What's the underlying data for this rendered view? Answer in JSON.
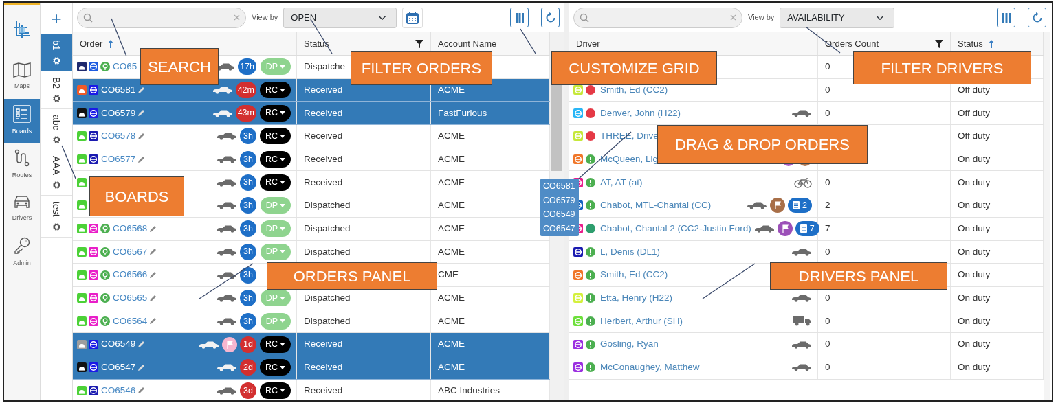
{
  "nav": {
    "items": [
      {
        "label": "Maps",
        "selected": false
      },
      {
        "label": "Boards",
        "selected": true
      },
      {
        "label": "Routes",
        "selected": false
      },
      {
        "label": "Drivers",
        "selected": false
      },
      {
        "label": "Admin",
        "selected": false
      }
    ]
  },
  "boards": {
    "add": "+",
    "tabs": [
      {
        "label": "b1",
        "selected": true
      },
      {
        "label": "B2",
        "selected": false
      },
      {
        "label": "abc",
        "selected": false
      },
      {
        "label": "AAA",
        "selected": false
      },
      {
        "label": "test",
        "selected": false
      }
    ]
  },
  "orders_panel": {
    "view_by_label": "View by",
    "view_by": "OPEN",
    "columns": [
      {
        "label": "Order",
        "sorted": true
      },
      {
        "label": "Status",
        "filtered": true
      },
      {
        "label": "Account Name"
      }
    ],
    "rows": [
      {
        "badges": [
          {
            "kind": "gauge",
            "color": "#1f2a6e"
          },
          {
            "kind": "wheel",
            "color": "#1e5be0"
          },
          {
            "kind": "round",
            "color": "#4caf50"
          }
        ],
        "order": "CO65",
        "selected": false,
        "flag": false,
        "age": {
          "label": "17h",
          "color": "#1e6fc7"
        },
        "stage": {
          "label": "DP",
          "color": "#8fd48f"
        },
        "status": "Dispatche"
      },
      {
        "badges": [
          {
            "kind": "gauge",
            "color": "#f05a28"
          },
          {
            "kind": "wheel",
            "color": "#1a1ae6"
          }
        ],
        "order": "CO6581",
        "selected": true,
        "flag": false,
        "age": {
          "label": "42m",
          "color": "#d32f2f"
        },
        "stage": {
          "label": "RC",
          "color": "#000000"
        },
        "status": "Received",
        "account": "ACME"
      },
      {
        "badges": [
          {
            "kind": "gauge",
            "color": "#111111"
          },
          {
            "kind": "wheel",
            "color": "#1a1ae6"
          }
        ],
        "order": "CO6579",
        "selected": true,
        "flag": false,
        "age": {
          "label": "43m",
          "color": "#d32f2f"
        },
        "stage": {
          "label": "RC",
          "color": "#000000"
        },
        "status": "Received",
        "account": "FastFurious"
      },
      {
        "badges": [
          {
            "kind": "gauge",
            "color": "#4cd137"
          },
          {
            "kind": "wheel",
            "color": "#1a1ab0"
          }
        ],
        "order": "CO6578",
        "selected": false,
        "flag": false,
        "age": {
          "label": "3h",
          "color": "#1e6fc7"
        },
        "stage": {
          "label": "RC",
          "color": "#000000"
        },
        "status": "Received",
        "account": "ACME"
      },
      {
        "badges": [
          {
            "kind": "gauge",
            "color": "#4cd137"
          },
          {
            "kind": "wheel",
            "color": "#1a1ab0"
          }
        ],
        "order": "CO6577",
        "selected": false,
        "flag": false,
        "age": {
          "label": "3h",
          "color": "#1e6fc7"
        },
        "stage": {
          "label": "RC",
          "color": "#000000"
        },
        "status": "Received",
        "account": "ACME"
      },
      {
        "badges": [
          {
            "kind": "gauge",
            "color": "#4cd137"
          }
        ],
        "selected": false,
        "flag": false,
        "age": {
          "label": "3h",
          "color": "#1e6fc7"
        },
        "stage": {
          "label": "RC",
          "color": "#000000"
        },
        "status": "Received",
        "account": "ACME"
      },
      {
        "badges": [
          {
            "kind": "gauge",
            "color": "#4cd137"
          }
        ],
        "selected": false,
        "flag": false,
        "age": {
          "label": "3h",
          "color": "#1e6fc7"
        },
        "stage": {
          "label": "DP",
          "color": "#8fd48f"
        },
        "status": "Dispatched",
        "account": "ACME"
      },
      {
        "badges": [
          {
            "kind": "gauge",
            "color": "#4cd137"
          },
          {
            "kind": "wheel",
            "color": "#e91ec8"
          },
          {
            "kind": "round",
            "color": "#4caf50"
          }
        ],
        "order": "CO6568",
        "selected": false,
        "flag": false,
        "age": {
          "label": "3h",
          "color": "#1e6fc7"
        },
        "stage": {
          "label": "DP",
          "color": "#8fd48f"
        },
        "status": "Dispatched",
        "account": "ACME"
      },
      {
        "badges": [
          {
            "kind": "gauge",
            "color": "#4cd137"
          },
          {
            "kind": "wheel",
            "color": "#e91ec8"
          },
          {
            "kind": "round",
            "color": "#4caf50"
          }
        ],
        "order": "CO6567",
        "selected": false,
        "flag": false,
        "age": {
          "label": "3h",
          "color": "#1e6fc7"
        },
        "stage": {
          "label": "DP",
          "color": "#8fd48f"
        },
        "status": "Dispatched",
        "account": "ACME"
      },
      {
        "badges": [
          {
            "kind": "gauge",
            "color": "#4cd137"
          },
          {
            "kind": "wheel",
            "color": "#e91ec8"
          },
          {
            "kind": "round",
            "color": "#4caf50"
          }
        ],
        "order": "CO6566",
        "selected": false,
        "flag": false,
        "age": {
          "label": "3h",
          "color": "#1e6fc7"
        },
        "account": "CME"
      },
      {
        "badges": [
          {
            "kind": "gauge",
            "color": "#4cd137"
          },
          {
            "kind": "wheel",
            "color": "#e91ec8"
          },
          {
            "kind": "round",
            "color": "#4caf50"
          }
        ],
        "order": "CO6565",
        "selected": false,
        "flag": false,
        "age": {
          "label": "3h",
          "color": "#1e6fc7"
        },
        "stage": {
          "label": "DP",
          "color": "#8fd48f"
        },
        "status": "Dispatched",
        "account": "ACME"
      },
      {
        "badges": [
          {
            "kind": "gauge",
            "color": "#4cd137"
          },
          {
            "kind": "wheel",
            "color": "#e91ec8"
          },
          {
            "kind": "round",
            "color": "#4caf50"
          }
        ],
        "order": "CO6564",
        "selected": false,
        "flag": false,
        "age": {
          "label": "3h",
          "color": "#1e6fc7"
        },
        "stage": {
          "label": "DP",
          "color": "#8fd48f"
        },
        "status": "Dispatched",
        "account": "ACME"
      },
      {
        "badges": [
          {
            "kind": "gauge",
            "color": "#9e9e9e"
          },
          {
            "kind": "wheel",
            "color": "#1a1ae6"
          }
        ],
        "order": "CO6549",
        "selected": true,
        "flag": true,
        "age": {
          "label": "1d",
          "color": "#d32f2f"
        },
        "stage": {
          "label": "RC",
          "color": "#000000"
        },
        "status": "Received",
        "account": "ACME"
      },
      {
        "badges": [
          {
            "kind": "gauge",
            "color": "#111111"
          },
          {
            "kind": "wheel",
            "color": "#1a1ae6"
          }
        ],
        "order": "CO6547",
        "selected": true,
        "flag": false,
        "age": {
          "label": "2d",
          "color": "#d32f2f"
        },
        "stage": {
          "label": "RC",
          "color": "#000000"
        },
        "status": "Received",
        "account": "ACME"
      },
      {
        "badges": [
          {
            "kind": "gauge",
            "color": "#4cd137"
          },
          {
            "kind": "wheel",
            "color": "#1a1ab0"
          }
        ],
        "order": "CO6546",
        "selected": false,
        "flag": false,
        "age": {
          "label": "3d",
          "color": "#d32f2f"
        },
        "stage": {
          "label": "RC",
          "color": "#000000"
        },
        "status": "Received",
        "account": "ABC Industries"
      }
    ]
  },
  "drivers_panel": {
    "view_by_label": "View by",
    "view_by": "AVAILABILITY",
    "columns": [
      {
        "label": "Driver"
      },
      {
        "label": "Orders Count",
        "filtered": true
      },
      {
        "label": "Status",
        "sorted": true
      }
    ],
    "rows": [
      {
        "count": "0"
      },
      {
        "square": {
          "color": "#c6e83a"
        },
        "indicator": {
          "kind": "dot",
          "color": "#e53945"
        },
        "name": "Smith, Ed (CC2)",
        "count": "0",
        "status": "Off duty"
      },
      {
        "square": {
          "color": "#29b6f6"
        },
        "indicator": {
          "kind": "dot",
          "color": "#e53945"
        },
        "name": "Denver, John (H22)",
        "vehicle": {
          "kind": "car"
        },
        "count": "0",
        "status": "Off duty"
      },
      {
        "square": {
          "color": "#c6e83a"
        },
        "indicator": {
          "kind": "dot",
          "color": "#e53945"
        },
        "name": "THREE, Drive",
        "status": "Off duty"
      },
      {
        "square": {
          "color": "#f0772a"
        },
        "indicator": {
          "kind": "alert",
          "color": "#4caf50"
        },
        "name": "McQueen, Lig",
        "markers": [
          {
            "kind": "dot",
            "color": "#a55cc4"
          },
          {
            "kind": "dot",
            "color": "#b07a55"
          }
        ],
        "status": "On duty"
      },
      {
        "square": {
          "color": "#e91e8c"
        },
        "indicator": {
          "kind": "alert",
          "color": "#4caf50"
        },
        "name": "AT, AT (at)",
        "vehicle": {
          "kind": "bike"
        },
        "count": "0",
        "status": "On duty"
      },
      {
        "square": {
          "color": "#1565c0"
        },
        "indicator": {
          "kind": "alert",
          "color": "#4caf50"
        },
        "name": "Chabot, MTL-Chantal (CC)",
        "vehicle": {
          "kind": "car"
        },
        "markers": [
          {
            "kind": "flag",
            "color": "#a86f48"
          },
          {
            "kind": "orders",
            "color": "#1e6fc7",
            "count": "2"
          }
        ],
        "count": "2",
        "status": "On duty"
      },
      {
        "square": {
          "color": "#e91e8c"
        },
        "indicator": {
          "kind": "dot",
          "color": "#2e9e6e"
        },
        "name": "Chabot, Chantal 2 (CC2-Justin Ford)",
        "vehicle": {
          "kind": "car"
        },
        "markers": [
          {
            "kind": "flag",
            "color": "#9b4fb8"
          },
          {
            "kind": "orders",
            "color": "#1e6fc7",
            "count": "7"
          }
        ],
        "count": "7",
        "status": "On duty"
      },
      {
        "square": {
          "color": "#1a1ab0"
        },
        "indicator": {
          "kind": "alert",
          "color": "#4caf50"
        },
        "name": "L, Denis (DL1)",
        "vehicle": {
          "kind": "car"
        },
        "count": "0",
        "status": "On duty"
      },
      {
        "square": {
          "color": "#f0772a"
        },
        "indicator": {
          "kind": "alert",
          "color": "#4caf50"
        },
        "name": "Smith, Ed (CC2)",
        "status": "On duty"
      },
      {
        "square": {
          "color": "#d4f03c"
        },
        "indicator": {
          "kind": "alert",
          "color": "#4caf50"
        },
        "name": "Etta, Henry (H22)",
        "vehicle": {
          "kind": "car"
        },
        "count": "0",
        "status": "On duty"
      },
      {
        "square": {
          "color": "#6ee03c"
        },
        "indicator": {
          "kind": "alert",
          "color": "#4caf50"
        },
        "name": "Herbert, Arthur (SH)",
        "vehicle": {
          "kind": "truck"
        },
        "count": "0",
        "status": "On duty"
      },
      {
        "square": {
          "color": "#9b30e0"
        },
        "indicator": {
          "kind": "alert",
          "color": "#4caf50"
        },
        "name": "Gosling, Ryan",
        "vehicle": {
          "kind": "car"
        },
        "count": "0",
        "status": "On duty"
      },
      {
        "square": {
          "color": "#9b30e0"
        },
        "indicator": {
          "kind": "alert",
          "color": "#4caf50"
        },
        "name": "McConaughey, Matthew",
        "vehicle": {
          "kind": "car"
        },
        "count": "0",
        "status": "On duty"
      }
    ]
  },
  "drag_preview": {
    "items": [
      "CO6581",
      "CO6579",
      "CO6549",
      "CO6547"
    ]
  },
  "callouts": [
    {
      "text": "SEARCH"
    },
    {
      "text": "FILTER ORDERS"
    },
    {
      "text": "CUSTOMIZE GRID"
    },
    {
      "text": "FILTER DRIVERS"
    },
    {
      "text": "DRAG & DROP ORDERS"
    },
    {
      "text": "BOARDS"
    },
    {
      "text": "ORDERS PANEL"
    },
    {
      "text": "DRIVERS PANEL"
    }
  ]
}
